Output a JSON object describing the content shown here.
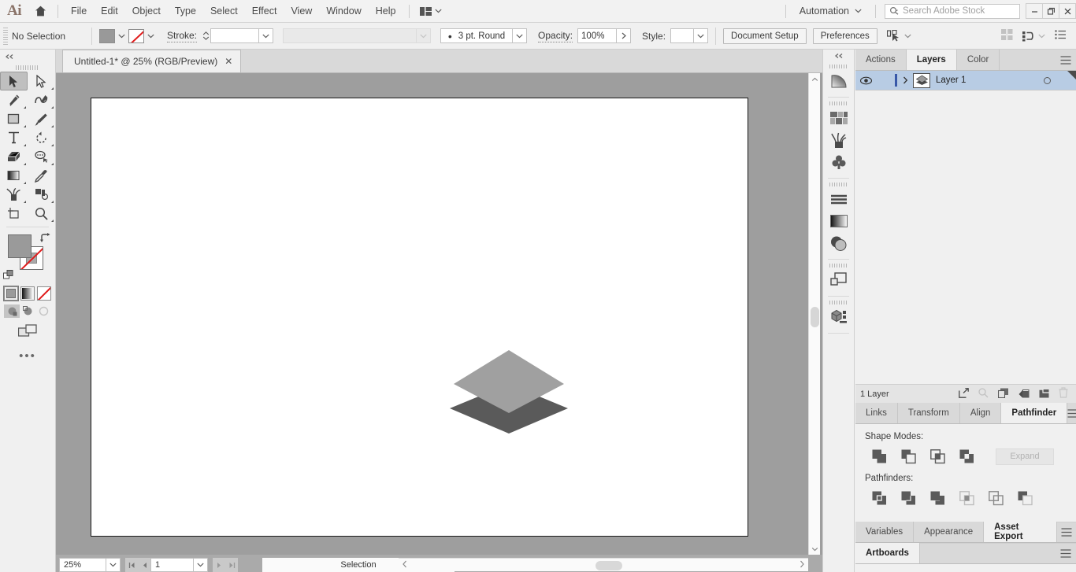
{
  "app": {
    "logo": "Ai",
    "home_icon": "home-icon"
  },
  "menubar": {
    "items": [
      "File",
      "Edit",
      "Object",
      "Type",
      "Select",
      "Effect",
      "View",
      "Window",
      "Help"
    ],
    "arrange_icon": "arrange-documents-icon",
    "automation_label": "Automation",
    "search_placeholder": "Search Adobe Stock",
    "search_icon": "search-icon",
    "window_buttons": [
      "minimize",
      "restore",
      "close"
    ]
  },
  "controlbar": {
    "selection_label": "No Selection",
    "fill_color": "#999999",
    "stroke_color": "none",
    "stroke_label": "Stroke:",
    "stroke_weight": "",
    "stroke_profile": "",
    "brush_definition": "3 pt. Round",
    "opacity_label": "Opacity:",
    "opacity_value": "100%",
    "style_label": "Style:",
    "document_setup_label": "Document Setup",
    "preferences_label": "Preferences",
    "select_similar_icon": "select-similar-objects-icon",
    "right_icons": [
      "align-icon",
      "distribute-icon",
      "document-options-icon"
    ]
  },
  "toolbar": {
    "collapse_icon": "double-chevron-left-icon",
    "tools": [
      {
        "name": "selection-tool",
        "icon": "arrow-solid-icon",
        "selected": true,
        "has_flyout": false
      },
      {
        "name": "direct-selection-tool",
        "icon": "arrow-hollow-icon",
        "selected": false,
        "has_flyout": true
      },
      {
        "name": "pen-tool",
        "icon": "pen-icon",
        "selected": false,
        "has_flyout": true
      },
      {
        "name": "curvature-tool",
        "icon": "curvature-icon",
        "selected": false,
        "has_flyout": true
      },
      {
        "name": "rectangle-tool",
        "icon": "rectangle-icon",
        "selected": false,
        "has_flyout": true
      },
      {
        "name": "paintbrush-tool",
        "icon": "paintbrush-icon",
        "selected": false,
        "has_flyout": true
      },
      {
        "name": "type-tool",
        "icon": "type-t-icon",
        "selected": false,
        "has_flyout": true
      },
      {
        "name": "rotate-tool",
        "icon": "rotate-icon",
        "selected": false,
        "has_flyout": true
      },
      {
        "name": "shaper-tool",
        "icon": "eraser-icon",
        "selected": false,
        "has_flyout": true
      },
      {
        "name": "width-tool",
        "icon": "blob-brush-icon",
        "selected": false,
        "has_flyout": true
      },
      {
        "name": "gradient-tool",
        "icon": "gradient-icon",
        "selected": false,
        "has_flyout": true
      },
      {
        "name": "eyedropper-tool",
        "icon": "eyedropper-icon",
        "selected": false,
        "has_flyout": false
      },
      {
        "name": "symbol-sprayer-tool",
        "icon": "symbol-sprayer-icon",
        "selected": false,
        "has_flyout": true
      },
      {
        "name": "graph-tool",
        "icon": "graph-icon",
        "selected": false,
        "has_flyout": true
      },
      {
        "name": "artboard-tool",
        "icon": "artboard-icon",
        "selected": false,
        "has_flyout": false
      },
      {
        "name": "zoom-tool",
        "icon": "magnifier-icon",
        "selected": false,
        "has_flyout": true
      }
    ],
    "fill_color": "#9a9a9a",
    "stroke_color": "none",
    "swap_icon": "swap-fill-stroke-icon",
    "default_icon": "default-fill-stroke-icon",
    "fill_modes": [
      {
        "name": "color-mode",
        "icon": "flat-color-icon",
        "active": true
      },
      {
        "name": "gradient-mode",
        "icon": "gradient-swatch-icon",
        "active": false
      },
      {
        "name": "none-mode",
        "icon": "none-swatch-icon",
        "active": false
      }
    ],
    "draw_modes": [
      {
        "name": "draw-normal",
        "icon": "draw-normal-icon",
        "active": true
      },
      {
        "name": "draw-behind",
        "icon": "draw-behind-icon",
        "active": false
      },
      {
        "name": "draw-inside",
        "icon": "draw-inside-icon",
        "active": false
      }
    ],
    "screen_mode_icon": "change-screen-mode-icon",
    "more_label": "•••"
  },
  "document": {
    "tab_title": "Untitled-1* @ 25% (RGB/Preview)",
    "close_icon": "close-icon",
    "artboard_background": "#ffffff",
    "canvas_background": "#9e9e9e",
    "artwork": {
      "name": "layers-diamond-artwork",
      "top_shape_color": "#a0a0a0",
      "bottom_shape_color": "#5a5a5a"
    }
  },
  "statusbar": {
    "zoom_value": "25%",
    "zoom_dropdown_icon": "chevron-down-icon",
    "first_artboard_icon": "first-artboard-icon",
    "prev_artboard_icon": "prev-artboard-icon",
    "artboard_number": "1",
    "artboard_dropdown_icon": "chevron-down-icon",
    "next_artboard_icon": "next-artboard-icon",
    "last_artboard_icon": "last-artboard-icon",
    "status_text": "Selection",
    "status_arrow_icon": "play-arrow-icon",
    "hscroll_left_icon": "chevron-left-icon",
    "hscroll_right_icon": "chevron-right-icon"
  },
  "icondock": {
    "collapse_icon": "double-chevron-left-icon",
    "groups": [
      {
        "items": [
          {
            "name": "gradient-panel-icon",
            "icon": "gradient-fan-icon"
          }
        ]
      },
      {
        "items": [
          {
            "name": "swatches-panel-icon",
            "icon": "swatches-grid-icon"
          },
          {
            "name": "brushes-panel-icon",
            "icon": "brushes-icon"
          },
          {
            "name": "symbols-panel-icon",
            "icon": "clubs-icon"
          }
        ]
      },
      {
        "items": [
          {
            "name": "stroke-panel-icon",
            "icon": "stroke-lines-icon"
          },
          {
            "name": "gradient-swatch-panel-icon",
            "icon": "gradient-bar-icon"
          },
          {
            "name": "transparency-panel-icon",
            "icon": "transparency-circles-icon"
          }
        ]
      },
      {
        "items": [
          {
            "name": "layers-panel-icon",
            "icon": "layers-squares-icon"
          }
        ]
      },
      {
        "items": [
          {
            "name": "3d-panel-icon",
            "icon": "cube-icon"
          }
        ]
      }
    ]
  },
  "panels": {
    "layers_group": {
      "tabs": [
        {
          "label": "Actions",
          "active": false,
          "name": "tab-actions"
        },
        {
          "label": "Layers",
          "active": true,
          "name": "tab-layers"
        },
        {
          "label": "Color",
          "active": false,
          "name": "tab-color"
        }
      ],
      "menu_icon": "panel-menu-icon",
      "rows": [
        {
          "name": "Layer 1",
          "visible": true,
          "locked": false,
          "selected": true,
          "eye_icon": "eye-icon",
          "expand_icon": "chevron-right-icon",
          "thumbnail_icon": "layer-thumbnail-icon",
          "target_icon": "target-circle-icon"
        }
      ],
      "footer_count": "1 Layer",
      "footer_icons": [
        {
          "name": "locate-object-button",
          "icon": "locate-object-icon"
        },
        {
          "name": "collect-export-button",
          "icon": "collect-export-icon"
        },
        {
          "name": "create-sublayer-button",
          "icon": "new-sublayer-icon"
        },
        {
          "name": "make-clipping-mask-button",
          "icon": "clipping-mask-icon"
        },
        {
          "name": "create-new-layer-button",
          "icon": "new-layer-icon"
        },
        {
          "name": "delete-selection-button",
          "icon": "trash-icon"
        }
      ]
    },
    "pathfinder_group": {
      "tabs": [
        {
          "label": "Links",
          "active": false,
          "name": "tab-links"
        },
        {
          "label": "Transform",
          "active": false,
          "name": "tab-transform"
        },
        {
          "label": "Align",
          "active": false,
          "name": "tab-align"
        },
        {
          "label": "Pathfinder",
          "active": true,
          "name": "tab-pathfinder"
        }
      ],
      "menu_icon": "panel-menu-icon",
      "shape_modes_label": "Shape Modes:",
      "shape_modes": [
        {
          "name": "unite-button",
          "icon": "unite-icon"
        },
        {
          "name": "minus-front-button",
          "icon": "minus-front-icon"
        },
        {
          "name": "intersect-button",
          "icon": "intersect-icon"
        },
        {
          "name": "exclude-button",
          "icon": "exclude-icon"
        }
      ],
      "expand_label": "Expand",
      "pathfinders_label": "Pathfinders:",
      "pathfinders": [
        {
          "name": "divide-button",
          "icon": "divide-icon"
        },
        {
          "name": "trim-button",
          "icon": "trim-icon"
        },
        {
          "name": "merge-button",
          "icon": "merge-icon"
        },
        {
          "name": "crop-button",
          "icon": "crop-icon"
        },
        {
          "name": "outline-button",
          "icon": "outline-icon"
        },
        {
          "name": "minus-back-button",
          "icon": "minus-back-icon"
        }
      ]
    },
    "export_group": {
      "tabs": [
        {
          "label": "Variables",
          "active": false,
          "name": "tab-variables"
        },
        {
          "label": "Appearance",
          "active": false,
          "name": "tab-appearance"
        },
        {
          "label": "Asset Export",
          "active": true,
          "name": "tab-asset-export"
        }
      ],
      "menu_icon": "panel-menu-icon"
    },
    "artboards_group": {
      "tabs": [
        {
          "label": "Artboards",
          "active": true,
          "name": "tab-artboards"
        }
      ],
      "menu_icon": "panel-menu-icon"
    }
  }
}
